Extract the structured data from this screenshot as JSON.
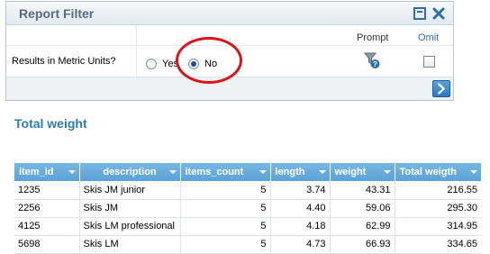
{
  "filter_panel": {
    "title": "Report Filter",
    "columns": {
      "prompt": "Prompt",
      "omit": "Omit"
    },
    "row": {
      "label": "Results in Metric Units?",
      "options": [
        {
          "label": "Yes",
          "selected": false
        },
        {
          "label": "No",
          "selected": true
        }
      ],
      "omit_checked": false
    },
    "icons": {
      "minimize": "minimize-icon",
      "close": "close-icon",
      "prompt": "funnel-question-icon",
      "go": "arrow-right-icon"
    }
  },
  "report": {
    "title": "Total weight",
    "columns": [
      "item_id",
      "description",
      "items_count",
      "length",
      "weight",
      "Total weigth"
    ],
    "rows": [
      [
        "1235",
        "Skis JM junior",
        "5",
        "3.74",
        "43.31",
        "216.55"
      ],
      [
        "2256",
        "Skis JM",
        "5",
        "4.40",
        "59.06",
        "295.30"
      ],
      [
        "4125",
        "Skis LM professional",
        "5",
        "4.18",
        "62.99",
        "314.95"
      ],
      [
        "5698",
        "Skis LM",
        "5",
        "4.73",
        "66.93",
        "334.65"
      ]
    ]
  },
  "colors": {
    "header_blue": "#5aa2d6",
    "title_blue": "#2a7bb0",
    "highlight_red": "#d7151b"
  }
}
